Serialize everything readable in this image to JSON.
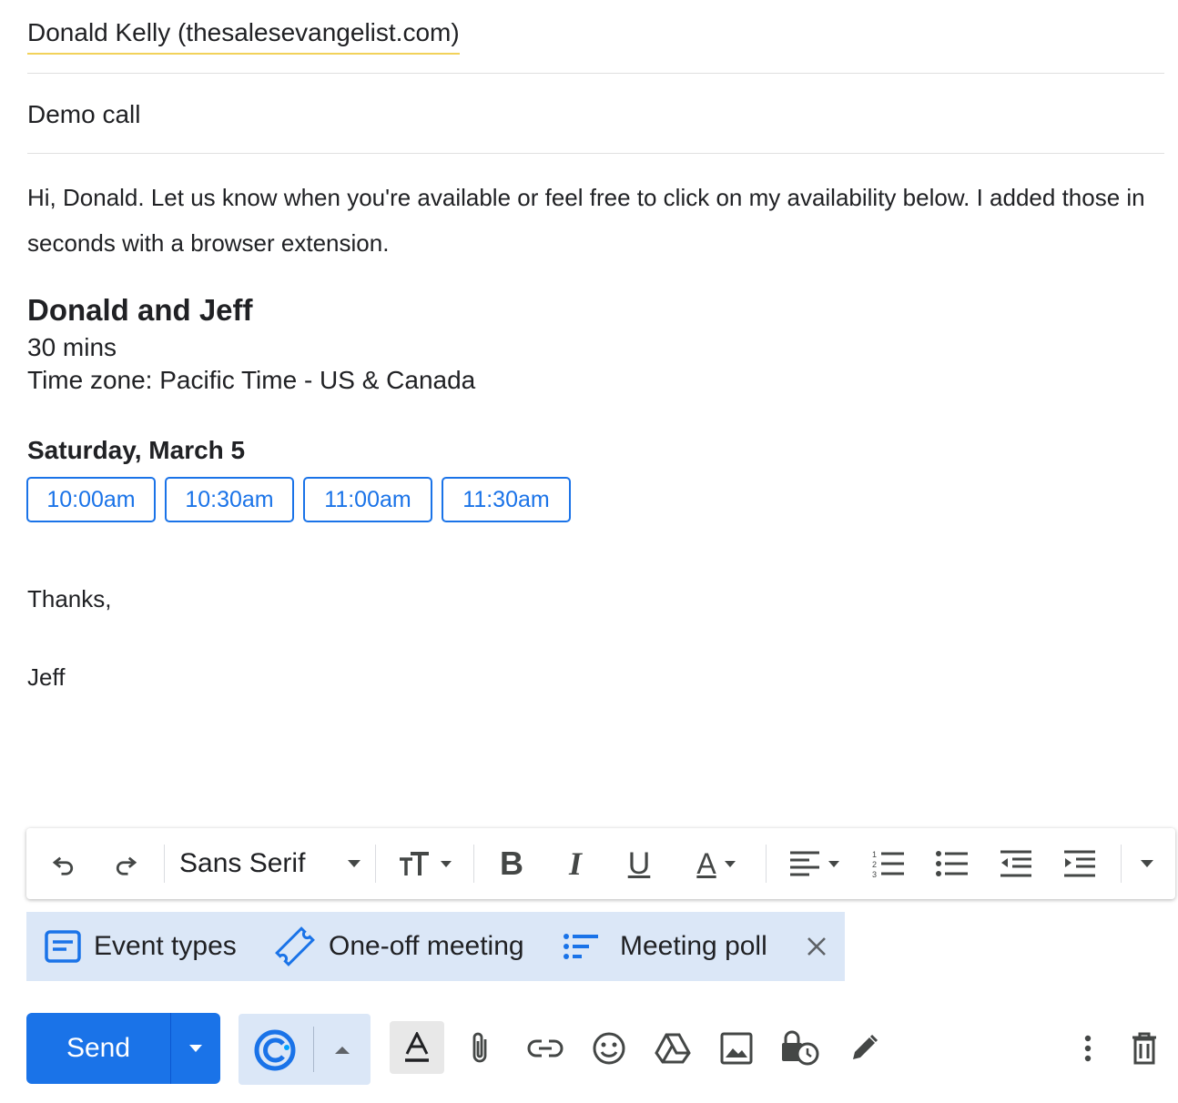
{
  "compose": {
    "recipient": "Donald Kelly (thesalesevangelist.com)",
    "subject": "Demo call",
    "body_intro": "Hi, Donald. Let us know when you're available or feel free to click on my availability below. I added those in seconds with a browser extension.",
    "closing": "Thanks,",
    "signature": "Jeff"
  },
  "event": {
    "title": "Donald and Jeff",
    "duration": "30 mins",
    "timezone": "Time zone: Pacific Time - US & Canada",
    "date": "Saturday, March 5",
    "slots": [
      "10:00am",
      "10:30am",
      "11:00am",
      "11:30am"
    ]
  },
  "toolbar": {
    "font": "Sans Serif",
    "icons": [
      "undo-icon",
      "redo-icon",
      "font-select",
      "text-size-icon",
      "bold-icon",
      "italic-icon",
      "underline-icon",
      "text-color-icon",
      "align-icon",
      "numbered-list-icon",
      "bulleted-list-icon",
      "indent-less-icon",
      "indent-more-icon",
      "more-formatting-icon"
    ]
  },
  "scheduling_bar": {
    "items": [
      {
        "label": "Event types",
        "icon": "event-types-icon"
      },
      {
        "label": "One-off meeting",
        "icon": "ticket-icon"
      },
      {
        "label": "Meeting poll",
        "icon": "poll-icon"
      }
    ]
  },
  "actions": {
    "send_label": "Send"
  },
  "colors": {
    "accent": "#1a73e8",
    "scheduling_bg": "#dbe7f7",
    "recipient_underline": "#f2d25a"
  }
}
